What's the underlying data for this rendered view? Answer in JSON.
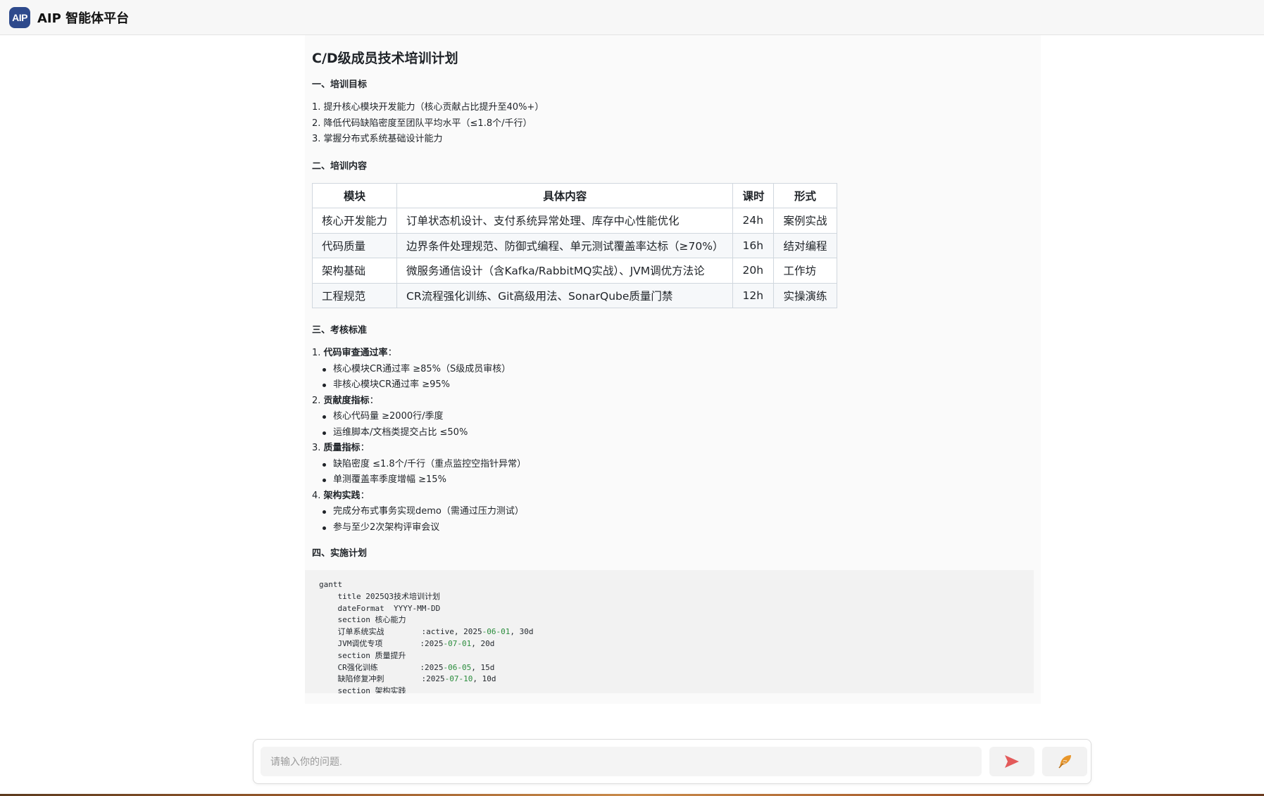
{
  "header": {
    "logo_text": "AIP",
    "app_title": "AIP 智能体平台"
  },
  "doc": {
    "title": "C/D级成员技术培训计划",
    "goals_heading": "一、培训目标",
    "goals": [
      "1. 提升核心模块开发能力（核心贡献占比提升至40%+）",
      "2. 降低代码缺陷密度至团队平均水平（≤1.8个/千行）",
      "3. 掌握分布式系统基础设计能力"
    ],
    "content_heading": "二、培训内容",
    "table": {
      "headers": [
        "模块",
        "具体内容",
        "课时",
        "形式"
      ],
      "rows": [
        [
          "核心开发能力",
          "订单状态机设计、支付系统异常处理、库存中心性能优化",
          "24h",
          "案例实战"
        ],
        [
          "代码质量",
          "边界条件处理规范、防御式编程、单元测试覆盖率达标（≥70%）",
          "16h",
          "结对编程"
        ],
        [
          "架构基础",
          "微服务通信设计（含Kafka/RabbitMQ实战）、JVM调优方法论",
          "20h",
          "工作坊"
        ],
        [
          "工程规范",
          "CR流程强化训练、Git高级用法、SonarQube质量门禁",
          "12h",
          "实操演练"
        ]
      ]
    },
    "assessment_heading": "三、考核标准",
    "assessment": [
      {
        "num": "1. ",
        "label": "代码审查通过率",
        "suffix": "：",
        "items": [
          "核心模块CR通过率 ≥85%（S级成员审核）",
          "非核心模块CR通过率 ≥95%"
        ]
      },
      {
        "num": "2. ",
        "label": "贡献度指标",
        "suffix": "：",
        "items": [
          "核心代码量 ≥2000行/季度",
          "运维脚本/文档类提交占比 ≤50%"
        ]
      },
      {
        "num": "3. ",
        "label": "质量指标",
        "suffix": "：",
        "items": [
          "缺陷密度 ≤1.8个/千行（重点监控空指针异常）",
          "单测覆盖率季度增幅 ≥15%"
        ]
      },
      {
        "num": "4. ",
        "label": "架构实践",
        "suffix": "：",
        "items": [
          "完成分布式事务实现demo（需通过压力测试）",
          "参与至少2次架构评审会议"
        ]
      }
    ],
    "plan_heading": "四、实施计划",
    "code_lines": [
      {
        "text": "gantt"
      },
      {
        "text": "    title 2025Q3技术培训计划"
      },
      {
        "text": "    dateFormat  YYYY-MM-DD"
      },
      {
        "text": "    section 核心能力"
      },
      {
        "pre": "    订单系统实战        :active, 2025",
        "d1": "-06",
        "d2": "-01",
        "post": ", 30d"
      },
      {
        "pre": "    JVM调优专项        :2025",
        "d1": "-07",
        "d2": "-01",
        "post": ", 20d"
      },
      {
        "text": "    section 质量提升"
      },
      {
        "pre": "    CR强化训练         :2025",
        "d1": "-06",
        "d2": "-05",
        "post": ", 15d"
      },
      {
        "pre": "    缺陷修复冲刺        :2025",
        "d1": "-07",
        "d2": "-10",
        "post": ", 10d"
      },
      {
        "text": "    section 架构实践"
      }
    ]
  },
  "input": {
    "placeholder": "请输入你的问题."
  },
  "colors": {
    "accent": "#2e4a8c",
    "send": "#e35a5a",
    "feather": "#e8962a",
    "code_number": "#2a8c3c"
  },
  "icons": {
    "send": "send-icon",
    "feather": "feather-icon"
  }
}
